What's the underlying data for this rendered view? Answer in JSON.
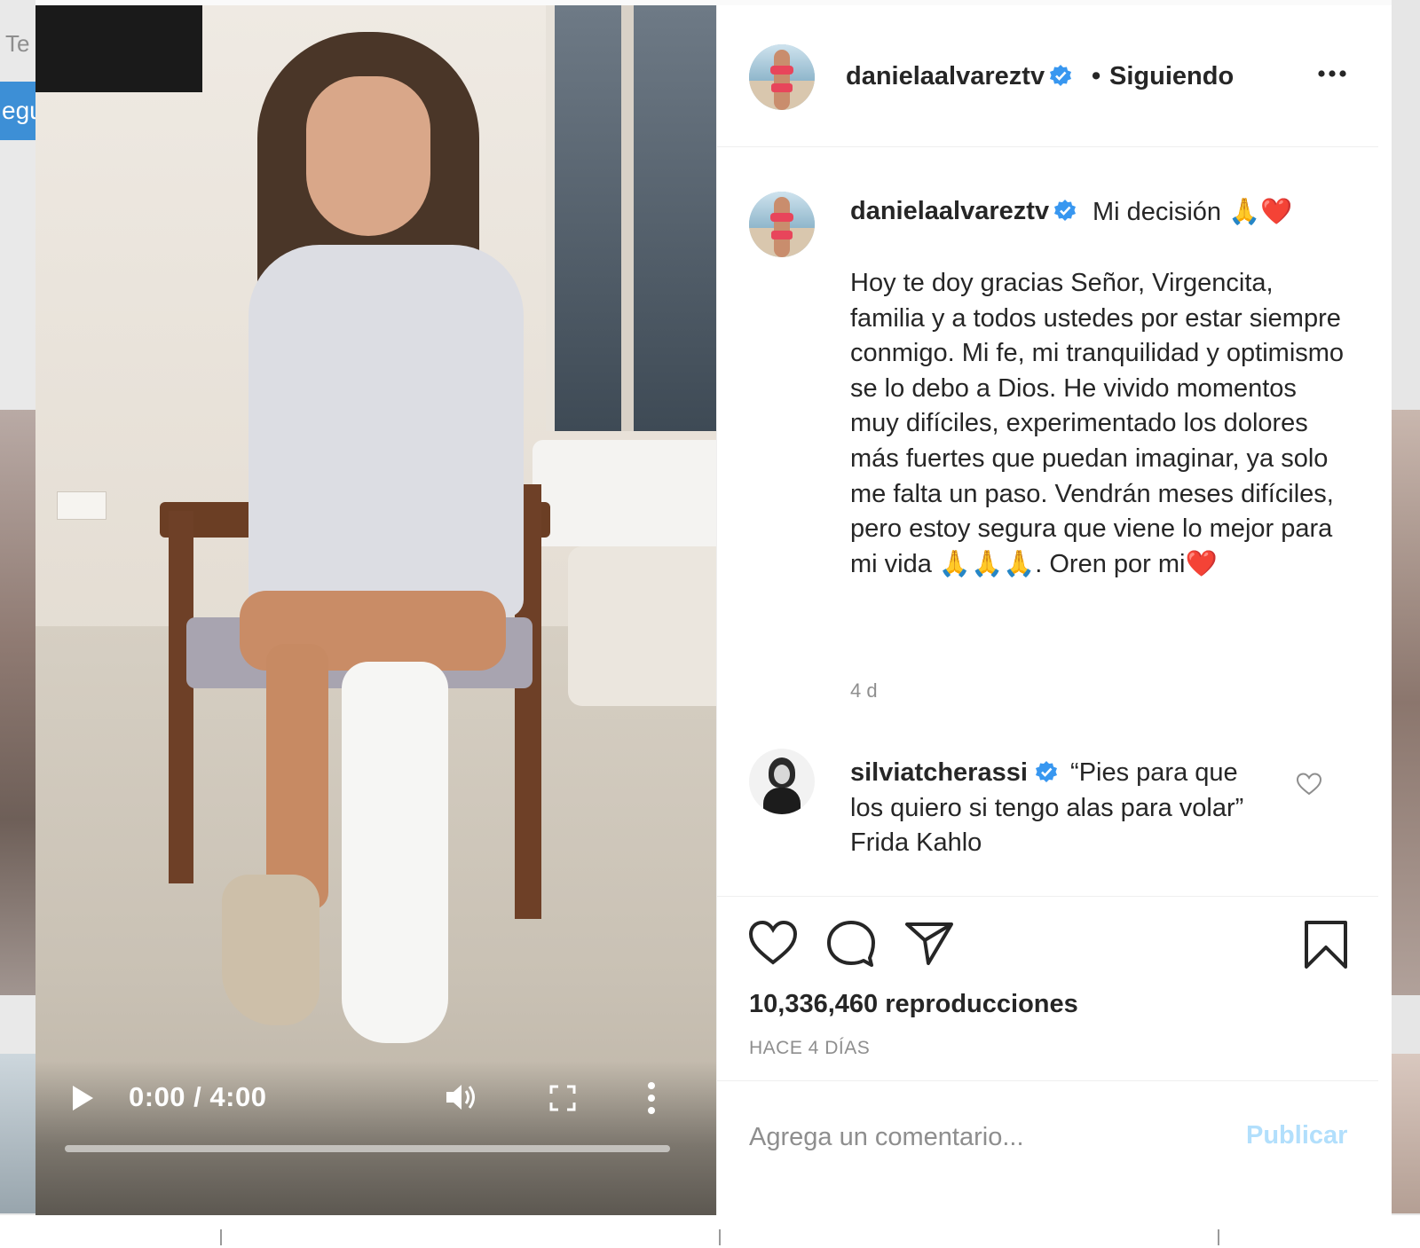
{
  "background": {
    "left_text": "Te",
    "left_button": "egu"
  },
  "video": {
    "time": "0:00 / 4:00",
    "progress_fraction": 0,
    "icons": {
      "play": "play-icon",
      "volume": "volume-icon",
      "fullscreen": "fullscreen-icon",
      "more": "vertical-dots-icon"
    }
  },
  "header": {
    "username": "danielaalvareztv",
    "separator": "•",
    "follow_status": "Siguiendo",
    "more_icon": "horizontal-dots-icon"
  },
  "caption": {
    "username": "danielaalvareztv",
    "title": "Mi decisión 🙏❤️",
    "body": "Hoy te doy gracias Señor, Virgencita, familia y a todos ustedes por estar siempre conmigo. Mi fe, mi tranquilidad y optimismo se lo debo a Dios. He vivido momentos muy difíciles, experimentado los dolores más fuertes que puedan imaginar, ya solo me falta un paso. Vendrán meses difíciles, pero estoy segura que viene lo mejor para mi vida 🙏🙏🙏. Oren por mi❤️",
    "time": "4 d"
  },
  "comment": {
    "username": "silviatcherassi",
    "text": "“Pies para que los quiero si tengo alas para volar” Frida Kahlo"
  },
  "actions": {
    "views": "10,336,460 reproducciones",
    "posted": "HACE 4 DÍAS"
  },
  "comment_box": {
    "placeholder": "Agrega un comentario...",
    "publish": "Publicar"
  },
  "colors": {
    "verified": "#3897f0",
    "publish_disabled": "#b2dffc",
    "secondary_text": "#8e8e8e",
    "heart_red": "#ed4956"
  }
}
